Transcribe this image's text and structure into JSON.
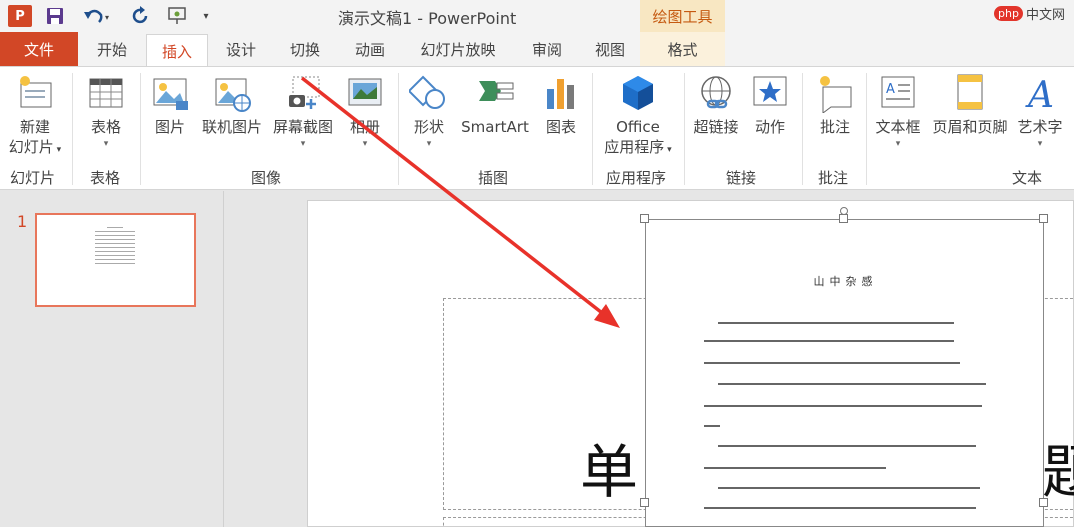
{
  "window": {
    "title": "演示文稿1 - PowerPoint",
    "context_title": "绘图工具",
    "app_letter": "P",
    "watermark_logo": "php",
    "watermark_site": "中文网"
  },
  "quick_access": {
    "save_icon": "save-icon",
    "undo_icon": "undo-icon",
    "redo_icon": "redo-icon",
    "present_icon": "present-icon",
    "customize_icon": "customize-icon"
  },
  "tabs": [
    "文件",
    "开始",
    "插入",
    "设计",
    "切换",
    "动画",
    "幻灯片放映",
    "审阅",
    "视图",
    "格式"
  ],
  "ribbon": {
    "groups": [
      "幻灯片",
      "表格",
      "图像",
      "插图",
      "应用程序",
      "链接",
      "批注",
      "文本"
    ],
    "buttons": {
      "new_slide": [
        "新建",
        "幻灯片"
      ],
      "table": "表格",
      "picture": "图片",
      "online_picture": "联机图片",
      "screenshot": "屏幕截图",
      "album": "相册",
      "shapes": "形状",
      "smartart": "SmartArt",
      "chart": "图表",
      "office_apps": [
        "Office",
        "应用程序"
      ],
      "hyperlink": "超链接",
      "action": "动作",
      "comment": "批注",
      "textbox": "文本框",
      "header_footer": "页眉和页脚",
      "wordart": "艺术字"
    }
  },
  "thumbnails": {
    "slide_number": "1"
  },
  "slide": {
    "title_char_left": "单",
    "title_char_right": "题",
    "picture_title": "山中杂感"
  },
  "colors": {
    "accent": "#d24726",
    "context": "#c55a11",
    "arrow": "#e8322a"
  }
}
